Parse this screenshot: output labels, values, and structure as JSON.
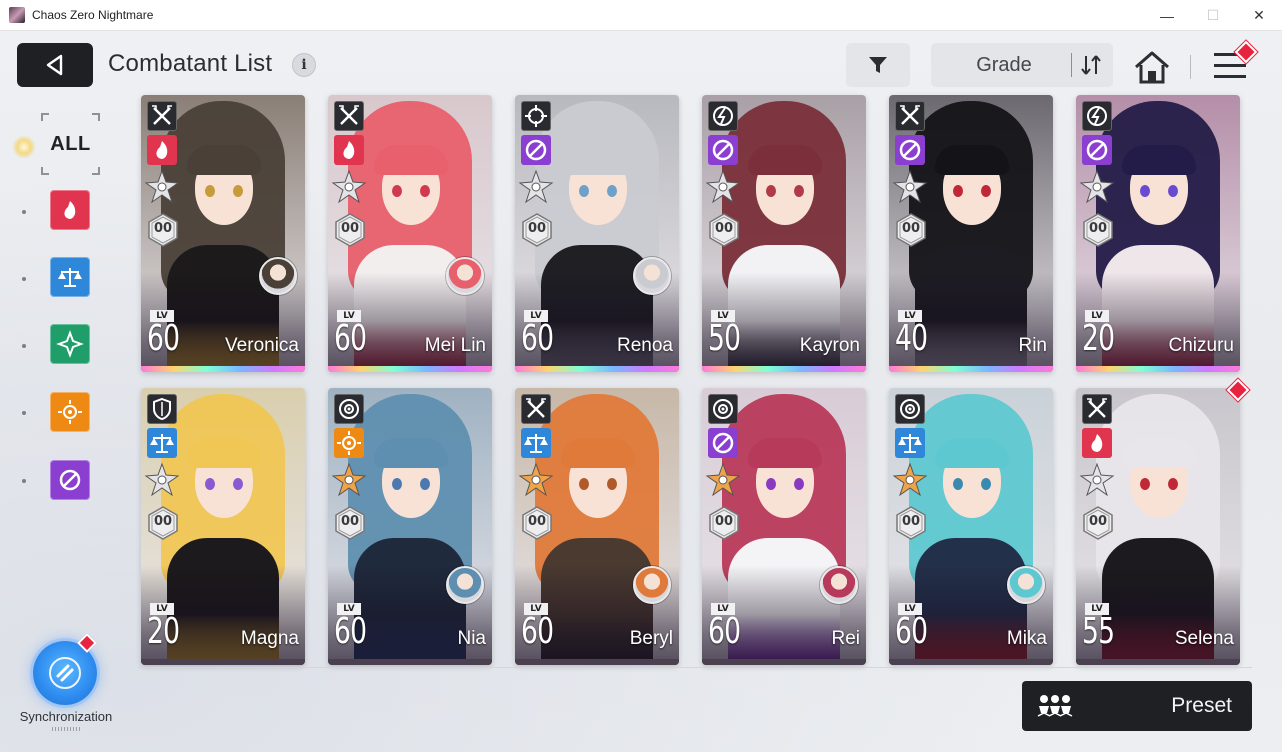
{
  "window": {
    "title": "Chaos Zero Nightmare",
    "minimize": "—",
    "maximize": "☐",
    "close": "✕"
  },
  "header": {
    "title": "Combatant List",
    "info": "i",
    "sort_label": "Grade"
  },
  "sidebar": {
    "all_label": "ALL",
    "elements": [
      {
        "name": "passion",
        "color": "#e0344f"
      },
      {
        "name": "order",
        "color": "#2f87d9"
      },
      {
        "name": "justice",
        "color": "#1f9e6a"
      },
      {
        "name": "instinct",
        "color": "#ee8a14"
      },
      {
        "name": "void",
        "color": "#8b3fd1"
      }
    ],
    "sync_label": "Synchronization"
  },
  "footer": {
    "preset_label": "Preset"
  },
  "combatants": [
    {
      "name": "Veronica",
      "level": "60",
      "level_tag": "LV",
      "job": "striker-icon",
      "element": "passion",
      "element_color": "#e0344f",
      "grade": "00",
      "hair": "#4a4038",
      "outfit": "#1c1a1a",
      "accent": "#f2c12e",
      "eye": "#c79a3a",
      "bg": "#8a7f76",
      "holo": true,
      "partner": true
    },
    {
      "name": "Mei Lin",
      "level": "60",
      "level_tag": "LV",
      "job": "striker-icon",
      "element": "passion",
      "element_color": "#e0344f",
      "grade": "00",
      "hair": "#e8606b",
      "outfit": "#f2eeee",
      "accent": "#c7283e",
      "eye": "#d03a4e",
      "bg": "#d8c8cc",
      "holo": true,
      "partner": true
    },
    {
      "name": "Renoa",
      "level": "60",
      "level_tag": "LV",
      "job": "hunter-icon",
      "element": "void",
      "element_color": "#8b3fd1",
      "grade": "00",
      "hair": "#c9cbd1",
      "outfit": "#1f1f24",
      "accent": "#8d8f96",
      "eye": "#6fa0c8",
      "bg": "#b8b9bf",
      "holo": true,
      "partner": true
    },
    {
      "name": "Kayron",
      "level": "50",
      "level_tag": "LV",
      "job": "psionic-icon",
      "element": "void",
      "element_color": "#8b3fd1",
      "grade": "00",
      "hair": "#7a2f3a",
      "outfit": "#f2f2f4",
      "accent": "#2a2a30",
      "eye": "#b03a48",
      "bg": "#a9a0a6",
      "holo": true,
      "partner": false
    },
    {
      "name": "Rin",
      "level": "40",
      "level_tag": "LV",
      "job": "striker-icon",
      "element": "void",
      "element_color": "#8b3fd1",
      "grade": "00",
      "hair": "#141418",
      "outfit": "#1d1c22",
      "accent": "#b8b8c0",
      "eye": "#c02838",
      "bg": "#6c6870",
      "holo": true,
      "partner": false
    },
    {
      "name": "Chizuru",
      "level": "20",
      "level_tag": "LV",
      "job": "psionic-icon",
      "element": "void",
      "element_color": "#8b3fd1",
      "grade": "00",
      "hair": "#241c48",
      "outfit": "#efe6ea",
      "accent": "#c0243c",
      "eye": "#6a4ad0",
      "bg": "#b48ea8",
      "holo": true,
      "partner": false
    },
    {
      "name": "Magna",
      "level": "20",
      "level_tag": "LV",
      "job": "vanguard-icon",
      "element": "order",
      "element_color": "#2f87d9",
      "grade": "00",
      "hair": "#f0c654",
      "outfit": "#1c1a1c",
      "accent": "#f2c12e",
      "eye": "#8a5ad0",
      "bg": "#d9cfae",
      "holo": false,
      "partner": false
    },
    {
      "name": "Nia",
      "level": "60",
      "level_tag": "LV",
      "job": "controller-icon",
      "element": "instinct",
      "element_color": "#ee8a14",
      "grade": "00",
      "hair": "#5f8fb0",
      "outfit": "#1f2a3c",
      "accent": "#2b4a78",
      "eye": "#4a7ab0",
      "bg": "#9fb2c2",
      "holo": false,
      "partner": true
    },
    {
      "name": "Beryl",
      "level": "60",
      "level_tag": "LV",
      "job": "striker-icon",
      "element": "order",
      "element_color": "#2f87d9",
      "grade": "00",
      "hair": "#e07a3a",
      "outfit": "#4a3a30",
      "accent": "#2a2a2a",
      "eye": "#b05a2a",
      "bg": "#c7b8a8",
      "holo": false,
      "partner": true
    },
    {
      "name": "Rei",
      "level": "60",
      "level_tag": "LV",
      "job": "controller-icon",
      "element": "void",
      "element_color": "#8b3fd1",
      "grade": "00",
      "hair": "#b83a5a",
      "outfit": "#f4f4f6",
      "accent": "#7a2ab0",
      "eye": "#8a3ac0",
      "bg": "#d8ccd6",
      "holo": false,
      "partner": true
    },
    {
      "name": "Mika",
      "level": "60",
      "level_tag": "LV",
      "job": "controller-icon",
      "element": "order",
      "element_color": "#2f87d9",
      "grade": "00",
      "hair": "#5ec8d0",
      "outfit": "#23304a",
      "accent": "#d02a2a",
      "eye": "#3a8ab0",
      "bg": "#c9d2d8",
      "holo": false,
      "partner": true
    },
    {
      "name": "Selena",
      "level": "55",
      "level_tag": "LV",
      "job": "striker-icon",
      "element": "passion",
      "element_color": "#e0344f",
      "grade": "00",
      "hair": "#e8e6ea",
      "outfit": "#1c1a1e",
      "accent": "#c02838",
      "eye": "#c02838",
      "bg": "#c8c6cc",
      "holo": false,
      "partner": false
    }
  ]
}
